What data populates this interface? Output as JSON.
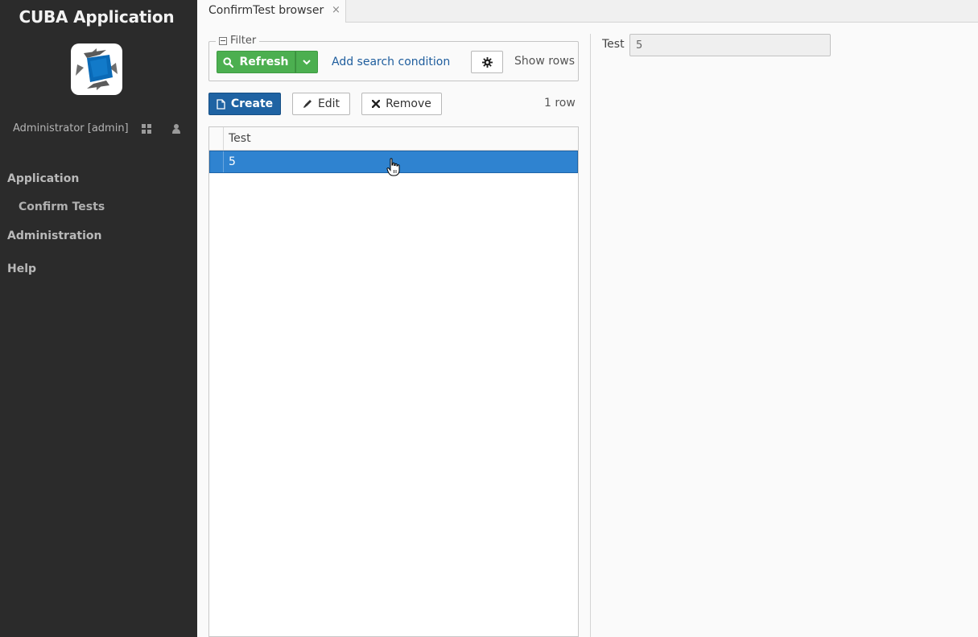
{
  "app": {
    "title": "CUBA Application",
    "brand_color": "#1f63a3"
  },
  "user": {
    "name": "Administrator [admin]",
    "icons": [
      "windows-icon",
      "user-icon"
    ]
  },
  "menu": {
    "items": [
      {
        "label": "Application",
        "children": [
          {
            "label": "Confirm Tests"
          }
        ]
      },
      {
        "label": "Administration"
      },
      {
        "label": "Help"
      }
    ]
  },
  "tabs": [
    {
      "label": "ConfirmTest browser",
      "close": "×"
    }
  ],
  "filter": {
    "legend": "Filter",
    "refresh_label": "Refresh",
    "add_condition_label": "Add search condition",
    "show_rows_label": "Show rows"
  },
  "toolbar": {
    "create_label": "Create",
    "edit_label": "Edit",
    "remove_label": "Remove",
    "row_count": "1 row"
  },
  "table": {
    "columns": [
      "Test"
    ],
    "rows": [
      [
        "5"
      ]
    ],
    "selected_row": 0
  },
  "detail": {
    "label": "Test",
    "value": "5"
  },
  "colors": {
    "sidebar_bg": "#2b2b2b",
    "refresh_green": "#4caf50",
    "selection_blue": "#2f83d0"
  }
}
